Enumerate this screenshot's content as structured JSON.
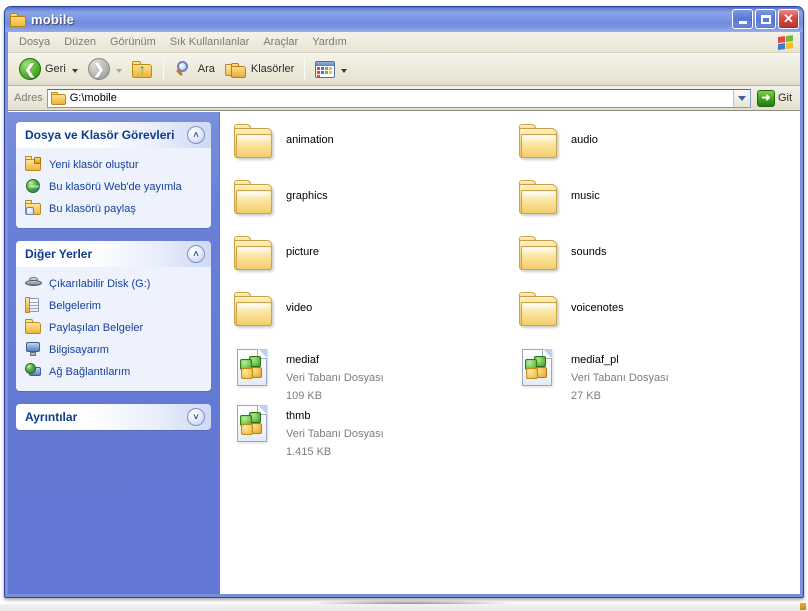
{
  "window": {
    "title": "mobile",
    "title_icon": "folder-icon",
    "minimize_label": "_",
    "maximize_label": "",
    "close_label": "✕"
  },
  "menu": {
    "items": [
      {
        "label": "Dosya"
      },
      {
        "label": "Düzen"
      },
      {
        "label": "Görünüm"
      },
      {
        "label": "Sık Kullanılanlar"
      },
      {
        "label": "Araçlar"
      },
      {
        "label": "Yardım"
      }
    ],
    "brand_icon": "windows-flag-icon"
  },
  "toolbar": {
    "back_label": "Geri",
    "back_icon": "back-arrow-icon",
    "forward_icon": "forward-arrow-icon",
    "up_icon": "up-folder-icon",
    "search_label": "Ara",
    "search_icon": "search-magnifier-icon",
    "folders_label": "Klasörler",
    "folders_icon": "folders-icon",
    "views_icon": "views-grid-icon"
  },
  "address": {
    "label": "Adres",
    "icon": "folder-icon",
    "value": "G:\\mobile",
    "dropdown_icon": "chevron-down-icon",
    "go_label": "Git",
    "go_icon": "go-arrow-icon"
  },
  "sidebar": {
    "panels": [
      {
        "title": "Dosya ve Klasör Görevleri",
        "chevron": "˄",
        "chevron_icon": "chevron-up-icon",
        "collapsed": false,
        "items": [
          {
            "label": "Yeni klasör oluştur",
            "icon": "new-folder-icon"
          },
          {
            "label": "Bu klasörü Web'de yayımla",
            "icon": "globe-icon"
          },
          {
            "label": "Bu klasörü paylaş",
            "icon": "share-folder-icon"
          }
        ]
      },
      {
        "title": "Diğer Yerler",
        "chevron": "˄",
        "chevron_icon": "chevron-up-icon",
        "collapsed": false,
        "items": [
          {
            "label": "Çıkarılabilir Disk (G:)",
            "icon": "removable-disk-icon"
          },
          {
            "label": "Belgelerim",
            "icon": "my-documents-icon"
          },
          {
            "label": "Paylaşılan Belgeler",
            "icon": "shared-documents-icon"
          },
          {
            "label": "Bilgisayarım",
            "icon": "my-computer-icon"
          },
          {
            "label": "Ağ Bağlantılarım",
            "icon": "network-icon"
          }
        ]
      },
      {
        "title": "Ayrıntılar",
        "chevron": "˅",
        "chevron_icon": "chevron-down-icon",
        "collapsed": true,
        "items": []
      }
    ]
  },
  "content": {
    "items": [
      {
        "name": "animation",
        "kind": "folder",
        "icon": "folder-icon",
        "type": "",
        "size": ""
      },
      {
        "name": "audio",
        "kind": "folder",
        "icon": "folder-icon",
        "type": "",
        "size": ""
      },
      {
        "name": "graphics",
        "kind": "folder",
        "icon": "folder-icon",
        "type": "",
        "size": ""
      },
      {
        "name": "music",
        "kind": "folder",
        "icon": "folder-icon",
        "type": "",
        "size": ""
      },
      {
        "name": "picture",
        "kind": "folder",
        "icon": "folder-icon",
        "type": "",
        "size": ""
      },
      {
        "name": "sounds",
        "kind": "folder",
        "icon": "folder-icon",
        "type": "",
        "size": ""
      },
      {
        "name": "video",
        "kind": "folder",
        "icon": "folder-icon",
        "type": "",
        "size": ""
      },
      {
        "name": "voicenotes",
        "kind": "folder",
        "icon": "folder-icon",
        "type": "",
        "size": ""
      },
      {
        "name": "mediaf",
        "kind": "file",
        "icon": "database-file-icon",
        "type": "Veri Tabanı Dosyası",
        "size": "109 KB"
      },
      {
        "name": "mediaf_pl",
        "kind": "file",
        "icon": "database-file-icon",
        "type": "Veri Tabanı Dosyası",
        "size": "27 KB"
      },
      {
        "name": "thmb",
        "kind": "file",
        "icon": "database-file-icon",
        "type": "Veri Tabanı Dosyası",
        "size": "1.415 KB"
      }
    ]
  },
  "colors": {
    "titlebar_blue": "#7d98e2",
    "sidebar_blue": "#6379d4",
    "panel_header_text": "#0c3a8c",
    "link_text": "#14409c",
    "toolbar_bg": "#efecde",
    "folder_yellow": "#f3cd6b",
    "close_red": "#cf4b43",
    "go_green": "#3da01d",
    "file_meta_gray": "#7c7c7c"
  }
}
